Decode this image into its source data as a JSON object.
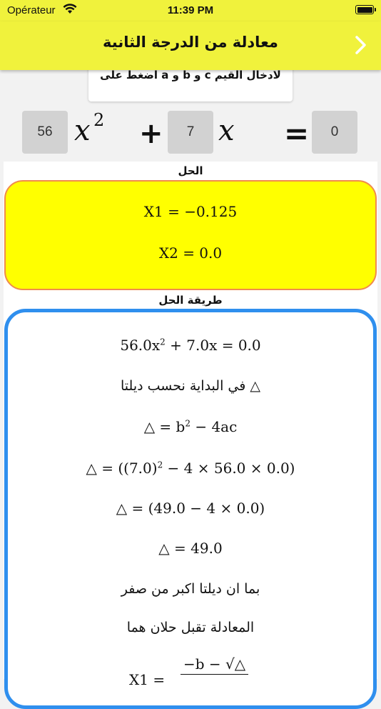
{
  "status_bar": {
    "carrier": "Opérateur",
    "time": "11:39 PM"
  },
  "nav": {
    "title": "معادلة من الدرجة الثانية",
    "back_icon": "chevron-right-icon"
  },
  "hint": {
    "text": "اضغط على a و b و c لادخال القيم"
  },
  "equation": {
    "a_value": "56",
    "b_value": "7",
    "c_value": "0",
    "x_squared": "x",
    "exponent": "2",
    "x_linear": "x",
    "plus": "+",
    "equals": "="
  },
  "solution": {
    "label": "الحل",
    "x1": "X1 = −0.125",
    "x2": "X2 = 0.0"
  },
  "method": {
    "label": "طريقة الحل",
    "steps": {
      "eq_a": "56.0x",
      "eq_exp": "2",
      "eq_rest": " + 7.0x = 0.0",
      "intro": "في البداية نحسب ديلتا △",
      "delta_formula_a": "△ = b",
      "delta_formula_exp": "2",
      "delta_formula_rest": " − 4ac",
      "delta_sub_a": "△ = ((7.0)",
      "delta_sub_exp": "2",
      "delta_sub_rest": " − 4 × 56.0 × 0.0)",
      "delta_simpl": "△ = (49.0 − 4 × 0.0)",
      "delta_value": "△ = 49.0",
      "since_positive": "بما ان ديلتا اكبر من صفر",
      "two_solutions": "المعادلة تقبل حلان هما",
      "x1_left": "X1 =",
      "x1_num": "−b − √△"
    }
  },
  "colors": {
    "bar_yellow": "#f0f23c",
    "answer_yellow": "#ffff00",
    "answer_border": "#f08b4c",
    "steps_border": "#2f8fee",
    "coef_bg": "#d2d2d2"
  }
}
